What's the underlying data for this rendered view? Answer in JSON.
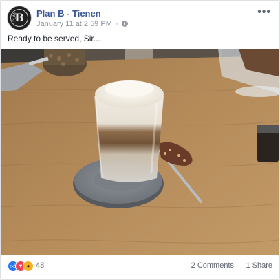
{
  "post": {
    "page_name": "Plan B - Tienen",
    "date": "January 11 at 2:59 PM",
    "separator": "·",
    "audience_icon": "globe-icon",
    "more_label": "•••",
    "text": "Ready to be served, Sir...",
    "avatar": {
      "letter": "B",
      "small_text": "PLAN"
    }
  },
  "footer": {
    "reaction_icons": [
      "like-icon",
      "love-icon",
      "wow-icon"
    ],
    "reaction_count": "48",
    "comments": "2 Comments",
    "shares": "1 Share"
  },
  "colors": {
    "link": "#385898",
    "meta": "#90949c",
    "like": "#2078f4",
    "love": "#f33e58",
    "wow": "#f7b125"
  }
}
